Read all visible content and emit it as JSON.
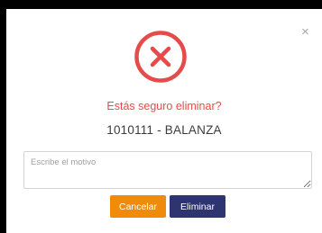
{
  "dialog": {
    "close_glyph": "×",
    "icon": "x-circle-icon",
    "title": "Estás seguro eliminar?",
    "item": "1010111 - BALANZA",
    "motivo_placeholder": "Escribe el motivo",
    "motivo_value": "",
    "cancel_label": "Cancelar",
    "delete_label": "Eliminar"
  },
  "colors": {
    "danger": "#e64b4b",
    "cancel": "#f08a0b",
    "delete": "#2e3470"
  }
}
